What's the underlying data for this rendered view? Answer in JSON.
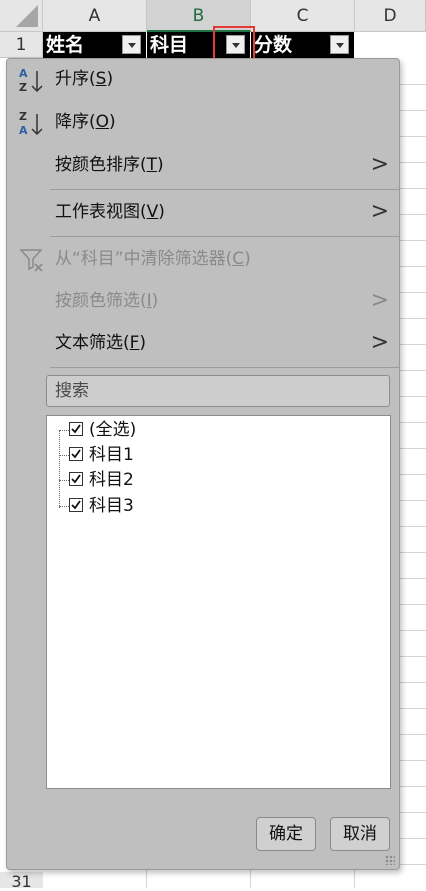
{
  "columns": [
    "A",
    "B",
    "C",
    "D"
  ],
  "rows": {
    "first": "1",
    "last": "31"
  },
  "header_cells": {
    "a": "姓名",
    "b": "科目",
    "c": "分数"
  },
  "menu": {
    "sort_asc": {
      "text": "升序(",
      "key": "S",
      "end": ")"
    },
    "sort_desc": {
      "text": "降序(",
      "key": "O",
      "end": ")"
    },
    "sort_by_color": {
      "text": "按颜色排序(",
      "key": "T",
      "end": ")",
      "arrow": ">"
    },
    "sheet_view": {
      "text": "工作表视图(",
      "key": "V",
      "end": ")",
      "arrow": ">"
    },
    "clear_filter": {
      "text": "从“科目”中清除筛选器(",
      "key": "C",
      "end": ")"
    },
    "filter_by_color": {
      "text": "按颜色筛选(",
      "key": "I",
      "end": ")",
      "arrow": ">"
    },
    "text_filter": {
      "text": "文本筛选(",
      "key": "F",
      "end": ")",
      "arrow": ">"
    }
  },
  "search": {
    "placeholder": "搜索"
  },
  "values_list": [
    {
      "label": "(全选)",
      "checked": true
    },
    {
      "label": "科目1",
      "checked": true
    },
    {
      "label": "科目2",
      "checked": true
    },
    {
      "label": "科目3",
      "checked": true
    }
  ],
  "buttons": {
    "ok": "确定",
    "cancel": "取消"
  },
  "colors": {
    "header_cell_bg": "#000000",
    "panel_bg": "#bfbfbf",
    "highlight": "#e53935",
    "active_col": "#217346"
  }
}
